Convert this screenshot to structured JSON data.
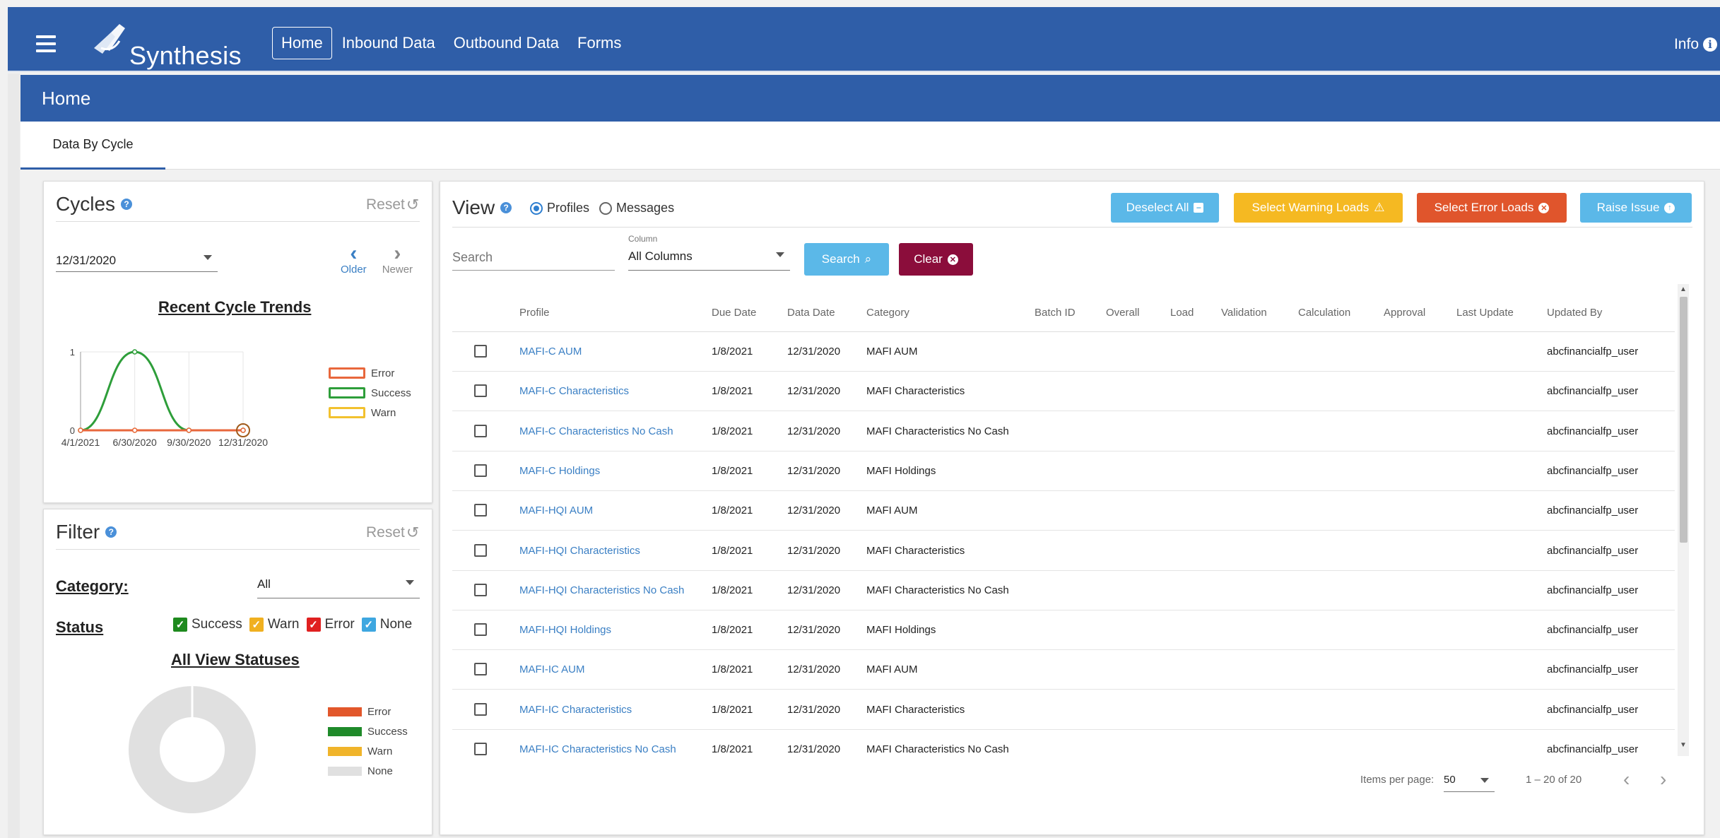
{
  "app": {
    "name": "Synthesis",
    "info_label": "Info"
  },
  "nav": {
    "items": [
      "Home",
      "Inbound Data",
      "Outbound Data",
      "Forms"
    ],
    "active": "Home"
  },
  "page": {
    "title": "Home",
    "tab": "Data By Cycle"
  },
  "cycles": {
    "title": "Cycles",
    "reset_label": "Reset",
    "selected_cycle": "12/31/2020",
    "older_label": "Older",
    "newer_label": "Newer",
    "chart_title": "Recent Cycle Trends"
  },
  "filter": {
    "title": "Filter",
    "reset_label": "Reset",
    "category_label": "Category:",
    "category_value": "All",
    "status_label": "Status",
    "statuses": [
      "Success",
      "Warn",
      "Error",
      "None"
    ],
    "status_colors": [
      "#1e8a1e",
      "#f0b020",
      "#e02020",
      "#3ea7e0"
    ],
    "chart_title": "All View Statuses"
  },
  "view": {
    "title": "View",
    "radio_profiles": "Profiles",
    "radio_messages": "Messages",
    "buttons": {
      "deselect_all": "Deselect All",
      "select_warning": "Select Warning Loads",
      "select_error": "Select Error Loads",
      "raise_issue": "Raise Issue",
      "search": "Search",
      "clear": "Clear"
    },
    "search_placeholder": "Search",
    "column_label": "Column",
    "column_value": "All Columns",
    "columns": [
      "Profile",
      "Due Date",
      "Data Date",
      "Category",
      "Batch ID",
      "Overall",
      "Load",
      "Validation",
      "Calculation",
      "Approval",
      "Last Update",
      "Updated By"
    ],
    "rows": [
      {
        "profile": "MAFI-C AUM",
        "due": "1/8/2021",
        "data": "12/31/2020",
        "category": "MAFI AUM",
        "user": "abcfinancialfp_user"
      },
      {
        "profile": "MAFI-C Characteristics",
        "due": "1/8/2021",
        "data": "12/31/2020",
        "category": "MAFI Characteristics",
        "user": "abcfinancialfp_user"
      },
      {
        "profile": "MAFI-C Characteristics No Cash",
        "due": "1/8/2021",
        "data": "12/31/2020",
        "category": "MAFI Characteristics No Cash",
        "user": "abcfinancialfp_user"
      },
      {
        "profile": "MAFI-C Holdings",
        "due": "1/8/2021",
        "data": "12/31/2020",
        "category": "MAFI Holdings",
        "user": "abcfinancialfp_user"
      },
      {
        "profile": "MAFI-HQI AUM",
        "due": "1/8/2021",
        "data": "12/31/2020",
        "category": "MAFI AUM",
        "user": "abcfinancialfp_user"
      },
      {
        "profile": "MAFI-HQI Characteristics",
        "due": "1/8/2021",
        "data": "12/31/2020",
        "category": "MAFI Characteristics",
        "user": "abcfinancialfp_user"
      },
      {
        "profile": "MAFI-HQI Characteristics No Cash",
        "due": "1/8/2021",
        "data": "12/31/2020",
        "category": "MAFI Characteristics No Cash",
        "user": "abcfinancialfp_user"
      },
      {
        "profile": "MAFI-HQI Holdings",
        "due": "1/8/2021",
        "data": "12/31/2020",
        "category": "MAFI Holdings",
        "user": "abcfinancialfp_user"
      },
      {
        "profile": "MAFI-IC AUM",
        "due": "1/8/2021",
        "data": "12/31/2020",
        "category": "MAFI AUM",
        "user": "abcfinancialfp_user"
      },
      {
        "profile": "MAFI-IC Characteristics",
        "due": "1/8/2021",
        "data": "12/31/2020",
        "category": "MAFI Characteristics",
        "user": "abcfinancialfp_user"
      },
      {
        "profile": "MAFI-IC Characteristics No Cash",
        "due": "1/8/2021",
        "data": "12/31/2020",
        "category": "MAFI Characteristics No Cash",
        "user": "abcfinancialfp_user"
      }
    ],
    "items_per_page_label": "Items per page:",
    "items_per_page": "50",
    "range_label": "1 – 20 of 20"
  },
  "chart_data": [
    {
      "type": "line",
      "title": "Recent Cycle Trends",
      "categories": [
        "4/1/2021",
        "6/30/2020",
        "9/30/2020",
        "12/31/2020"
      ],
      "ylim": [
        0,
        1
      ],
      "yticks": [
        "0",
        "1"
      ],
      "series": [
        {
          "name": "Error",
          "values": [
            0,
            0,
            0,
            0
          ],
          "color": "#e8673c"
        },
        {
          "name": "Success",
          "values": [
            0,
            1,
            0,
            0
          ],
          "color": "#2e9e3a"
        },
        {
          "name": "Warn",
          "values": [
            0,
            0,
            0,
            0
          ],
          "color": "#f2c12e"
        }
      ],
      "legend": "right"
    },
    {
      "type": "pie",
      "title": "All View Statuses",
      "labels": [
        "Error",
        "Success",
        "Warn",
        "None"
      ],
      "values": [
        0,
        0,
        0,
        20
      ],
      "colors": [
        "#e2572b",
        "#1f8a2a",
        "#f0b42a",
        "#e0e0e0"
      ],
      "legend": "right"
    }
  ]
}
